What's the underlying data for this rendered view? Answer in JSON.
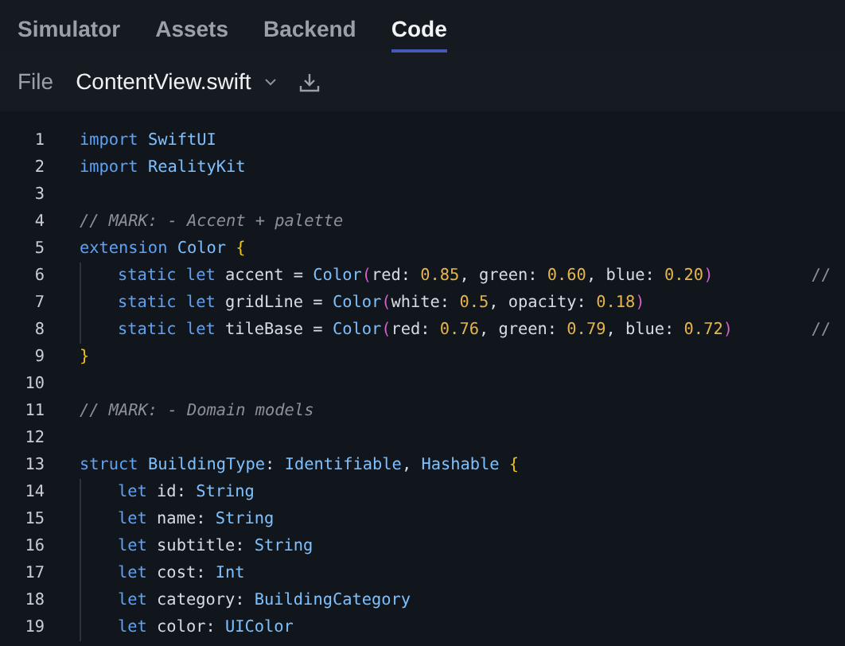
{
  "tabs": [
    {
      "label": "Simulator",
      "selected": false
    },
    {
      "label": "Assets",
      "selected": false
    },
    {
      "label": "Backend",
      "selected": false
    },
    {
      "label": "Code",
      "selected": true
    }
  ],
  "toolbar": {
    "label": "File",
    "file_menu": "ContentView.swift"
  },
  "code_lines": [
    {
      "number": "1",
      "tokens": [
        {
          "kind": "keyword",
          "text": "import "
        },
        {
          "kind": "type",
          "text": "SwiftUI"
        }
      ]
    },
    {
      "number": "2",
      "tokens": [
        {
          "kind": "keyword",
          "text": "import "
        },
        {
          "kind": "type",
          "text": "RealityKit"
        }
      ]
    },
    {
      "number": "3"
    },
    {
      "number": "4",
      "tokens": [
        {
          "kind": "comment",
          "text": "// MARK: - Accent + palette"
        }
      ]
    },
    {
      "number": "5",
      "tokens": [
        {
          "kind": "keyword",
          "text": "extension "
        },
        {
          "kind": "type",
          "text": "Color "
        },
        {
          "kind": "brace",
          "text": "{"
        }
      ],
      "children": [
        {
          "number": "6",
          "tokens": [
            {
              "kind": "keyword",
              "text": "static let "
            },
            {
              "kind": "plain",
              "text": "accent = "
            },
            {
              "kind": "type",
              "text": "Color"
            },
            {
              "kind": "paren",
              "text": "("
            },
            {
              "kind": "plain",
              "text": "red: "
            },
            {
              "kind": "number",
              "text": "0.85"
            },
            {
              "kind": "plain",
              "text": ", green: "
            },
            {
              "kind": "number",
              "text": "0.60"
            },
            {
              "kind": "plain",
              "text": ", blue: "
            },
            {
              "kind": "number",
              "text": "0.20"
            },
            {
              "kind": "paren",
              "text": ")"
            },
            {
              "kind": "trailing",
              "text": "//"
            }
          ]
        },
        {
          "number": "7",
          "tokens": [
            {
              "kind": "keyword",
              "text": "static let "
            },
            {
              "kind": "plain",
              "text": "gridLine = "
            },
            {
              "kind": "type",
              "text": "Color"
            },
            {
              "kind": "paren",
              "text": "("
            },
            {
              "kind": "plain",
              "text": "white: "
            },
            {
              "kind": "number",
              "text": "0.5"
            },
            {
              "kind": "plain",
              "text": ", opacity: "
            },
            {
              "kind": "number",
              "text": "0.18"
            },
            {
              "kind": "paren",
              "text": ")"
            }
          ]
        },
        {
          "number": "8",
          "tokens": [
            {
              "kind": "keyword",
              "text": "static let "
            },
            {
              "kind": "plain",
              "text": "tileBase = "
            },
            {
              "kind": "type",
              "text": "Color"
            },
            {
              "kind": "paren",
              "text": "("
            },
            {
              "kind": "plain",
              "text": "red: "
            },
            {
              "kind": "number",
              "text": "0.76"
            },
            {
              "kind": "plain",
              "text": ", green: "
            },
            {
              "kind": "number",
              "text": "0.79"
            },
            {
              "kind": "plain",
              "text": ", blue: "
            },
            {
              "kind": "number",
              "text": "0.72"
            },
            {
              "kind": "paren",
              "text": ")"
            },
            {
              "kind": "trailing",
              "text": "//"
            }
          ]
        }
      ]
    },
    {
      "number": "9",
      "tokens": [
        {
          "kind": "brace",
          "text": "}"
        }
      ]
    },
    {
      "number": "10"
    },
    {
      "number": "11",
      "tokens": [
        {
          "kind": "comment",
          "text": "// MARK: - Domain models"
        }
      ]
    },
    {
      "number": "12"
    },
    {
      "number": "13",
      "tokens": [
        {
          "kind": "keyword",
          "text": "struct "
        },
        {
          "kind": "type",
          "text": "BuildingType"
        },
        {
          "kind": "plain",
          "text": ": "
        },
        {
          "kind": "type",
          "text": "Identifiable"
        },
        {
          "kind": "plain",
          "text": ", "
        },
        {
          "kind": "type",
          "text": "Hashable "
        },
        {
          "kind": "brace",
          "text": "{"
        }
      ],
      "children": [
        {
          "number": "14",
          "tokens": [
            {
              "kind": "keyword",
              "text": "let "
            },
            {
              "kind": "plain",
              "text": "id: "
            },
            {
              "kind": "type",
              "text": "String"
            }
          ]
        },
        {
          "number": "15",
          "tokens": [
            {
              "kind": "keyword",
              "text": "let "
            },
            {
              "kind": "plain",
              "text": "name: "
            },
            {
              "kind": "type",
              "text": "String"
            }
          ]
        },
        {
          "number": "16",
          "tokens": [
            {
              "kind": "keyword",
              "text": "let "
            },
            {
              "kind": "plain",
              "text": "subtitle: "
            },
            {
              "kind": "type",
              "text": "String"
            }
          ]
        },
        {
          "number": "17",
          "tokens": [
            {
              "kind": "keyword",
              "text": "let "
            },
            {
              "kind": "plain",
              "text": "cost: "
            },
            {
              "kind": "type",
              "text": "Int"
            }
          ]
        },
        {
          "number": "18",
          "tokens": [
            {
              "kind": "keyword",
              "text": "let "
            },
            {
              "kind": "plain",
              "text": "category: "
            },
            {
              "kind": "type",
              "text": "BuildingCategory"
            }
          ]
        },
        {
          "number": "19",
          "tokens": [
            {
              "kind": "keyword",
              "text": "let "
            },
            {
              "kind": "plain",
              "text": "color: "
            },
            {
              "kind": "type",
              "text": "UIColor"
            }
          ]
        }
      ]
    }
  ]
}
